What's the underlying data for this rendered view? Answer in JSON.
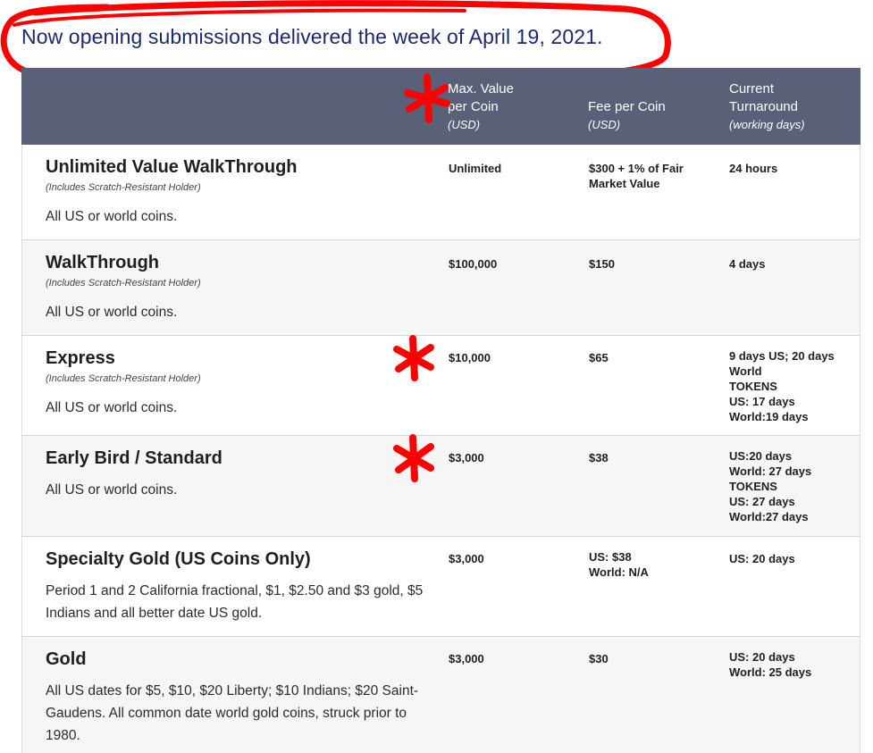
{
  "announcement": "Now opening submissions delivered the week of April 19, 2021.",
  "table": {
    "headers": {
      "max_value_line1": "Max. Value",
      "max_value_line2": "per Coin",
      "max_value_unit": "(USD)",
      "fee": "Fee per Coin",
      "fee_unit": "(USD)",
      "turnaround_line1": "Current",
      "turnaround_line2": "Turnaround",
      "turnaround_unit": "(working days)"
    },
    "rows": [
      {
        "name": "Unlimited Value WalkThrough",
        "note": "(Includes Scratch-Resistant Holder)",
        "description": "All US or world coins.",
        "max_value": "Unlimited",
        "fee": "$300 + 1% of Fair Market Value",
        "turnaround": [
          "24 hours"
        ]
      },
      {
        "name": "WalkThrough",
        "note": "(Includes Scratch-Resistant Holder)",
        "description": "All US or world coins.",
        "max_value": "$100,000",
        "fee": "$150",
        "turnaround": [
          "4 days"
        ]
      },
      {
        "name": "Express",
        "note": "(Includes Scratch-Resistant Holder)",
        "description": "All US or world coins.",
        "max_value": "$10,000",
        "fee": "$65",
        "turnaround": [
          "9 days US; 20 days World",
          "TOKENS",
          "US: 17 days",
          "World:19 days"
        ]
      },
      {
        "name": "Early Bird / Standard",
        "note": "",
        "description": "All US or world coins.",
        "max_value": "$3,000",
        "fee": "$38",
        "turnaround": [
          "US:20 days",
          "World: 27 days",
          "TOKENS",
          "US: 27 days",
          "World:27 days"
        ]
      },
      {
        "name": "Specialty Gold (US Coins Only)",
        "note": "",
        "description": "Period 1 and 2 California fractional, $1, $2.50 and $3 gold, $5 Indians and all better date US gold.",
        "max_value": "$3,000",
        "fee": [
          "US: $38",
          "World: N/A"
        ],
        "turnaround": [
          "US: 20 days"
        ]
      },
      {
        "name": "Gold",
        "note": "",
        "description": "All US dates for $5, $10, $20 Liberty; $10 Indians; $20 Saint-Gaudens. All common date world gold coins, struck prior to 1980.",
        "max_value": "$3,000",
        "fee": "$30",
        "turnaround": [
          "US: 20 days",
          "World: 25 days"
        ]
      }
    ]
  },
  "colors": {
    "header_bg": "#5b6079",
    "announcement_text": "#1a2a6c",
    "marker_red": "#ff0000",
    "alt_row_bg": "#f6f6f6"
  }
}
